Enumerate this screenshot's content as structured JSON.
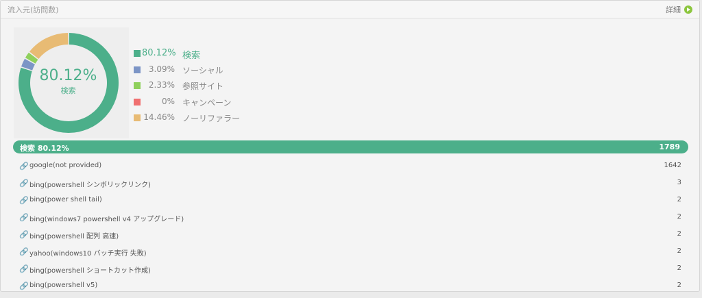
{
  "panel": {
    "title": "流入元(訪問数)",
    "detail_label": "詳細"
  },
  "donut": {
    "center_percent": "80.12%",
    "center_label": "検索"
  },
  "legend": [
    {
      "percent": "80.12%",
      "name": "検索",
      "color": "#4caf8a"
    },
    {
      "percent": "3.09%",
      "name": "ソーシャル",
      "color": "#7c95c6"
    },
    {
      "percent": "2.33%",
      "name": "参照サイト",
      "color": "#8fd05c"
    },
    {
      "percent": "0%",
      "name": "キャンペーン",
      "color": "#f07070"
    },
    {
      "percent": "14.46%",
      "name": "ノーリファラー",
      "color": "#e8bb74"
    }
  ],
  "chart_data": {
    "type": "pie",
    "categories": [
      "検索",
      "ソーシャル",
      "参照サイト",
      "キャンペーン",
      "ノーリファラー"
    ],
    "values": [
      80.12,
      3.09,
      2.33,
      0,
      14.46
    ]
  },
  "summary": {
    "label": "検索 80.12%",
    "count": "1789"
  },
  "referrers": [
    {
      "name": "google(not provided)",
      "count": "1642"
    },
    {
      "name": "bing(powershell シンボリックリンク)",
      "count": "3"
    },
    {
      "name": "bing(power shell tail)",
      "count": "2"
    },
    {
      "name": "bing(windows7 powershell v4 アップグレード)",
      "count": "2"
    },
    {
      "name": "bing(powershell 配列 高速)",
      "count": "2"
    },
    {
      "name": "yahoo(windows10 バッチ実行 失敗)",
      "count": "2"
    },
    {
      "name": "bing(powershell ショートカット作成)",
      "count": "2"
    },
    {
      "name": "bing(powershell v5)",
      "count": "2"
    }
  ]
}
